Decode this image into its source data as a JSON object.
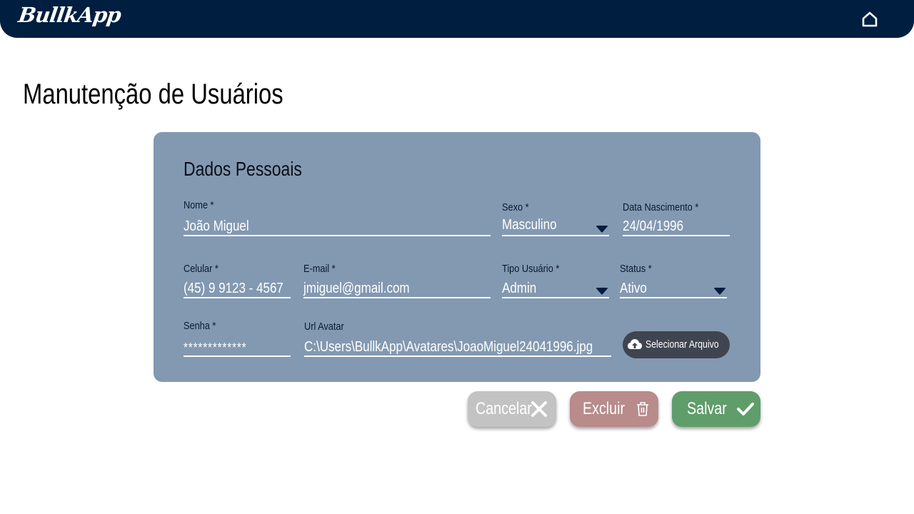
{
  "header": {
    "logo_text": "BullkApp",
    "home_icon": "home-icon",
    "bg_color": "#001e3f"
  },
  "page": {
    "title": "Manutenção de Usuários"
  },
  "form": {
    "section_title": "Dados Pessoais",
    "nome": {
      "label": "Nome *",
      "value": "João Miguel"
    },
    "sexo": {
      "label": "Sexo *",
      "value": "Masculino"
    },
    "data_nascimento": {
      "label": "Data Nascimento *",
      "value": "24/04/1996"
    },
    "celular": {
      "label": "Celular *",
      "value": "(45) 9 9123 - 4567"
    },
    "email": {
      "label": "E-mail *",
      "value": "jmiguel@gmail.com"
    },
    "tipo_usuario": {
      "label": "Tipo Usuário *",
      "value": "Admin"
    },
    "status": {
      "label": "Status *",
      "value": "Ativo"
    },
    "senha": {
      "label": "Senha *",
      "value": "*************"
    },
    "url_avatar": {
      "label": "Url Avatar",
      "value": "C:\\Users\\BullkApp\\Avatares\\JoaoMiguel24041996.jpg"
    },
    "upload_button": {
      "label": "Selecionar Arquivo",
      "icon": "cloud-upload-icon"
    },
    "card_color": "#8399b1"
  },
  "actions": {
    "cancel": {
      "label": "Cancelar",
      "icon": "close-icon",
      "color": "#c3c3c3"
    },
    "delete": {
      "label": "Excluir",
      "icon": "trash-icon",
      "color": "#b98b8b"
    },
    "save": {
      "label": "Salvar",
      "icon": "check-icon",
      "color": "#5f9d6a"
    }
  }
}
